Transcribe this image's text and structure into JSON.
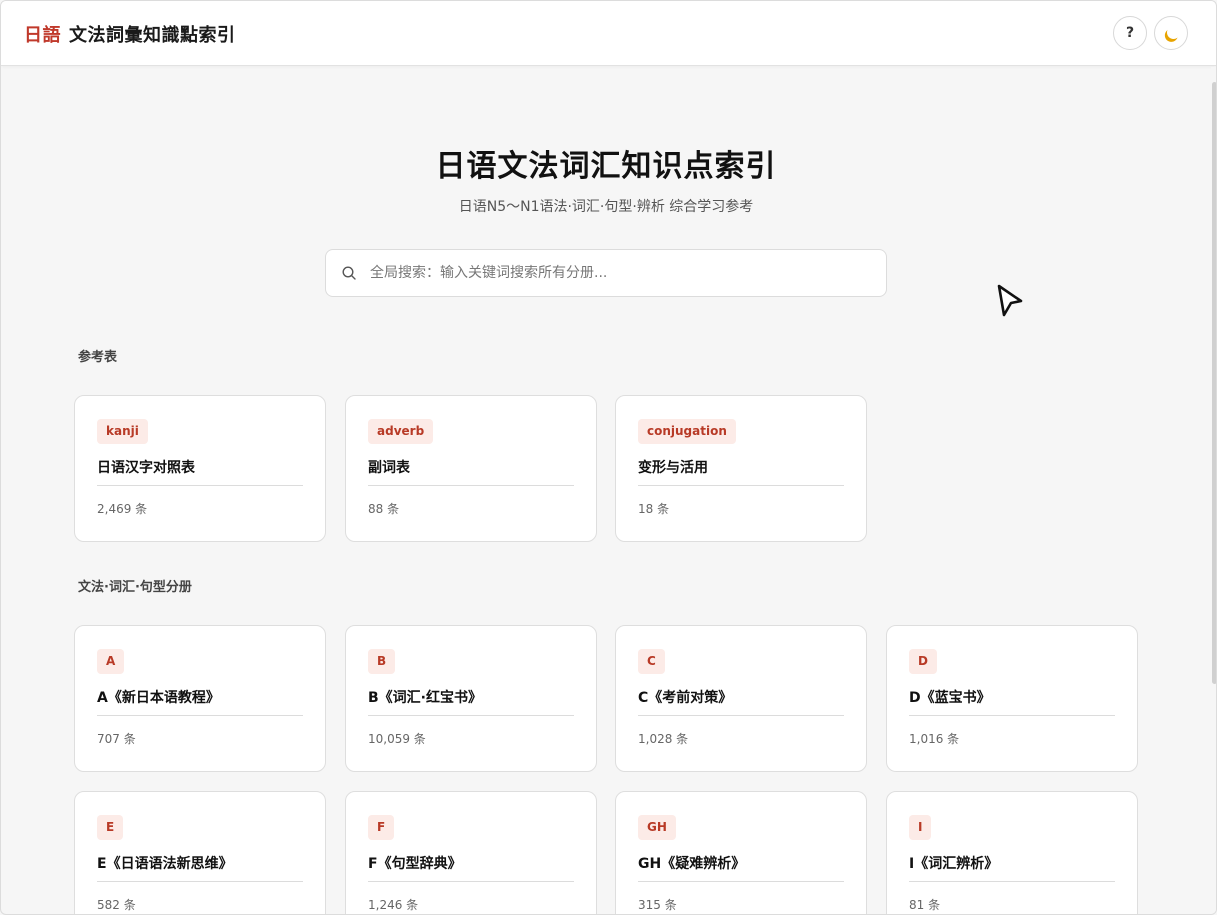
{
  "header": {
    "brand_mark": "日語",
    "brand_name": "文法詞彙知識點索引",
    "help_label": "?",
    "icons": {
      "help": "question-icon",
      "theme": "moon-icon",
      "search": "search-icon"
    }
  },
  "hero": {
    "title": "日语文法词汇知识点索引",
    "subtitle": "日语N5〜N1语法·词汇·句型·辨析 综合学习参考"
  },
  "search": {
    "placeholder": "全局搜索：输入关键词搜索所有分册...",
    "value": ""
  },
  "sections": [
    {
      "label": "参考表",
      "cards": [
        {
          "tag": "kanji",
          "title": "日语汉字对照表",
          "count": "2,469 条"
        },
        {
          "tag": "adverb",
          "title": "副词表",
          "count": "88 条"
        },
        {
          "tag": "conjugation",
          "title": "变形与活用",
          "count": "18 条"
        }
      ]
    },
    {
      "label": "文法·词汇·句型分册",
      "cards": [
        {
          "tag": "A",
          "title": "A《新日本语教程》",
          "count": "707 条"
        },
        {
          "tag": "B",
          "title": "B《词汇·红宝书》",
          "count": "10,059 条"
        },
        {
          "tag": "C",
          "title": "C《考前对策》",
          "count": "1,028 条"
        },
        {
          "tag": "D",
          "title": "D《蓝宝书》",
          "count": "1,016 条"
        },
        {
          "tag": "E",
          "title": "E《日语语法新思维》",
          "count": "582 条"
        },
        {
          "tag": "F",
          "title": "F《句型辞典》",
          "count": "1,246 条"
        },
        {
          "tag": "GH",
          "title": "GH《疑难辨析》",
          "count": "315 条"
        },
        {
          "tag": "I",
          "title": "I《词汇辨析》",
          "count": "81 条"
        }
      ]
    }
  ],
  "colors": {
    "accent": "#c0392b",
    "tag_bg": "#fcebe7",
    "tag_text": "#b83a26",
    "page_bg": "#f6f6f6",
    "card_bg": "#ffffff",
    "moon": "#e8a400"
  }
}
